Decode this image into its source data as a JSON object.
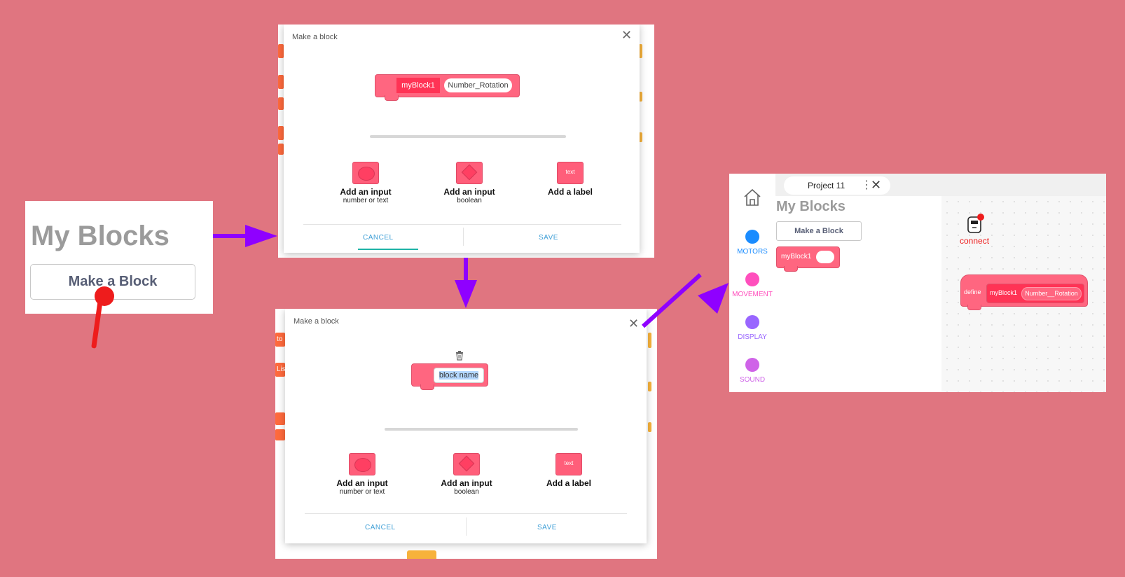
{
  "panel1": {
    "title": "My Blocks",
    "button_label": "Make a Block"
  },
  "dialog1": {
    "title": "Make a block",
    "preview_block_name": "myBlock1",
    "preview_input_name": "Number_Rotation",
    "options": [
      {
        "icon": "oval-input-icon",
        "label": "Add an input",
        "sub": "number or text"
      },
      {
        "icon": "boolean-input-icon",
        "label": "Add an input",
        "sub": "boolean"
      },
      {
        "icon": "label-icon",
        "label": "Add a label",
        "sub": ""
      }
    ],
    "label_chip_text": "text",
    "cancel_label": "CANCEL",
    "save_label": "SAVE"
  },
  "dialog2": {
    "title": "Make a block",
    "name_field_value": "block name",
    "options": [
      {
        "icon": "oval-input-icon",
        "label": "Add an input",
        "sub": "number or text"
      },
      {
        "icon": "boolean-input-icon",
        "label": "Add an input",
        "sub": "boolean"
      },
      {
        "icon": "label-icon",
        "label": "Add a label",
        "sub": ""
      }
    ],
    "label_chip_text": "text",
    "cancel_label": "CANCEL",
    "save_label": "SAVE"
  },
  "editor": {
    "tab_title": "Project 11",
    "palette_title": "My Blocks",
    "make_block_label": "Make a Block",
    "palette_block_name": "myBlock1",
    "categories": [
      {
        "label": "MOTORS",
        "color": "#1a8cff"
      },
      {
        "label": "MOVEMENT",
        "color": "#ff4fbd"
      },
      {
        "label": "DISPLAY",
        "color": "#9966ff"
      },
      {
        "label": "SOUND",
        "color": "#cf63e8"
      }
    ],
    "connect_label": "connect",
    "define_label": "define",
    "define_block_name": "myBlock1",
    "define_input_name": "Number__Rotation"
  },
  "colors": {
    "background": "#e07580",
    "arrow": "#8f00ff",
    "cursor": "#ee1c1c",
    "block": "#ff6680"
  }
}
